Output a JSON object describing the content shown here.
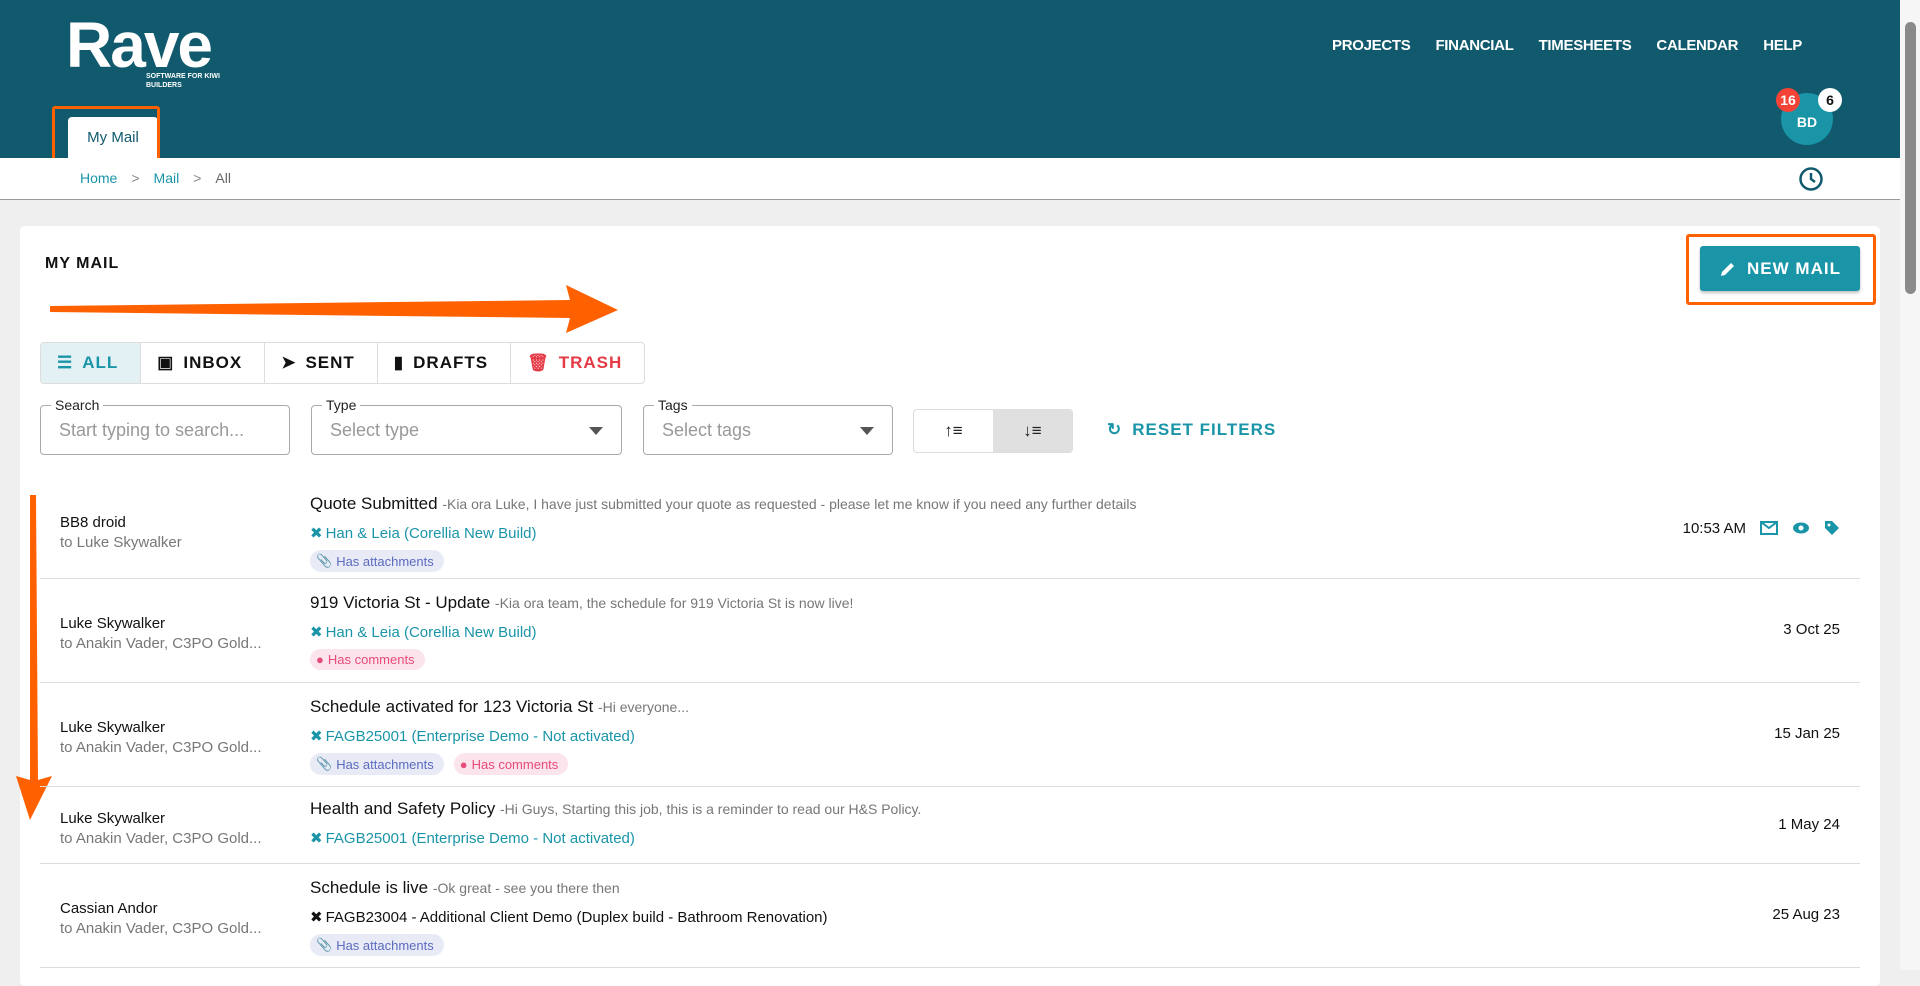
{
  "header": {
    "logo": "Rave",
    "logo_tagline": "SOFTWARE FOR KIWI BUILDERS",
    "nav": [
      "PROJECTS",
      "FINANCIAL",
      "TIMESHEETS",
      "CALENDAR",
      "HELP"
    ],
    "tab": "My Mail",
    "avatar": "BD",
    "badge_red": "16",
    "badge_white": "6"
  },
  "breadcrumb": {
    "home": "Home",
    "mail": "Mail",
    "current": "All",
    "sep": ">"
  },
  "page": {
    "title": "MY MAIL",
    "new_mail": "NEW MAIL"
  },
  "tabs": [
    "ALL",
    "INBOX",
    "SENT",
    "DRAFTS",
    "TRASH"
  ],
  "filters": {
    "search_label": "Search",
    "search_placeholder": "Start typing to search...",
    "type_label": "Type",
    "type_placeholder": "Select type",
    "tags_label": "Tags",
    "tags_placeholder": "Select tags",
    "reset": "RESET FILTERS"
  },
  "colors": {
    "header": "#115a6e",
    "accent": "#1a95a8",
    "trash": "#e53945",
    "annotation": "#ff6000"
  },
  "mails": [
    {
      "from": "BB8 droid",
      "to": "to Luke Skywalker",
      "subject": "Quote Submitted",
      "preview": "-Kia ora Luke, I have just submitted your quote as requested - please let me know if you need any further details",
      "project": "Han & Leia (Corellia New Build)",
      "chips": [
        "Has attachments"
      ],
      "date": "10:53 AM"
    },
    {
      "from": "Luke Skywalker",
      "to": "to Anakin Vader, C3PO Gold...",
      "subject": "919 Victoria St - Update",
      "preview": "-Kia ora team, the schedule for 919 Victoria St is now live!",
      "project": "Han & Leia (Corellia New Build)",
      "chips": [
        "Has comments"
      ],
      "date": "3 Oct 25"
    },
    {
      "from": "Luke Skywalker",
      "to": "to Anakin Vader, C3PO Gold...",
      "subject": "Schedule activated for 123 Victoria St",
      "preview": "-Hi everyone...",
      "project": "FAGB25001 (Enterprise Demo - Not activated)",
      "chips": [
        "Has attachments",
        "Has comments"
      ],
      "date": "15 Jan 25"
    },
    {
      "from": "Luke Skywalker",
      "to": "to Anakin Vader, C3PO Gold...",
      "subject": "Health and Safety Policy",
      "preview": "-Hi Guys, Starting this job, this is a reminder to read our H&S Policy.",
      "project": "FAGB25001 (Enterprise Demo - Not activated)",
      "chips": [],
      "date": "1 May 24"
    },
    {
      "from": "Cassian Andor",
      "to": "to Anakin Vader, C3PO Gold...",
      "subject": "Schedule is live",
      "preview": "-Ok great - see you there then",
      "project": "FAGB23004 - Additional Client Demo (Duplex build - Bathroom Renovation)",
      "chips": [
        "Has attachments"
      ],
      "date": "25 Aug 23"
    }
  ]
}
